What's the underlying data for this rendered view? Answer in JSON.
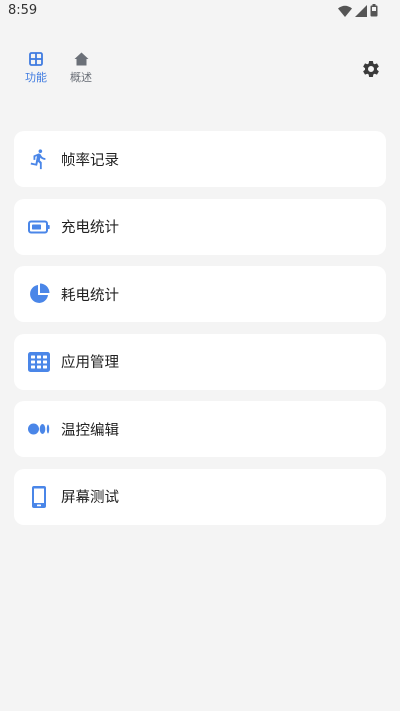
{
  "status_bar": {
    "time": "8:59",
    "icons": [
      "wifi-icon",
      "cell-signal-icon",
      "battery-icon"
    ]
  },
  "nav": {
    "tabs": [
      {
        "label": "功能",
        "icon": "grid-icon",
        "active": true
      },
      {
        "label": "概述",
        "icon": "home-icon",
        "active": false
      }
    ],
    "settings_icon": "gear-icon"
  },
  "menu": {
    "items": [
      {
        "label": "帧率记录",
        "icon": "running-person-icon"
      },
      {
        "label": "充电统计",
        "icon": "battery-outline-icon"
      },
      {
        "label": "耗电统计",
        "icon": "pie-chart-icon"
      },
      {
        "label": "应用管理",
        "icon": "app-grid-icon"
      },
      {
        "label": "温控编辑",
        "icon": "dots-icon"
      },
      {
        "label": "屏幕测试",
        "icon": "phone-icon"
      }
    ]
  },
  "colors": {
    "accent": "#3f7be0",
    "icon_blue": "#4a86e8",
    "background": "#f4f4f4",
    "card": "#ffffff",
    "inactive_tab": "#6b7078"
  }
}
